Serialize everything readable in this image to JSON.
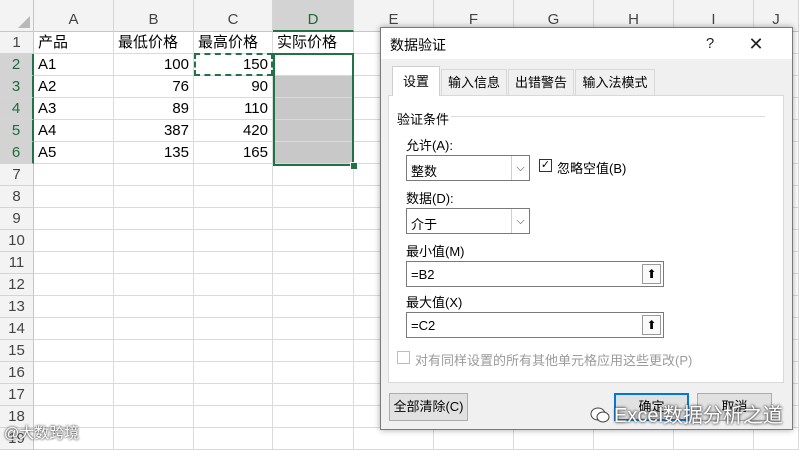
{
  "sheet": {
    "columns": [
      "A",
      "B",
      "C",
      "D",
      "E",
      "F",
      "G",
      "H",
      "I",
      "J"
    ],
    "rows": [
      "1",
      "2",
      "3",
      "4",
      "5",
      "6",
      "7",
      "8",
      "9",
      "10",
      "11",
      "12",
      "13",
      "14",
      "15",
      "16",
      "17",
      "18",
      "19"
    ],
    "header_row": [
      "产品",
      "最低价格",
      "最高价格",
      "实际价格"
    ],
    "data": [
      {
        "product": "A1",
        "min": "100",
        "max": "150"
      },
      {
        "product": "A2",
        "min": "76",
        "max": "90"
      },
      {
        "product": "A3",
        "min": "89",
        "max": "110"
      },
      {
        "product": "A4",
        "min": "387",
        "max": "420"
      },
      {
        "product": "A5",
        "min": "135",
        "max": "165"
      }
    ],
    "selected_column": "D",
    "accent": "#217346"
  },
  "dialog": {
    "title": "数据验证",
    "help": "?",
    "close": "✕",
    "tabs": [
      "设置",
      "输入信息",
      "出错警告",
      "输入法模式"
    ],
    "active_tab": "设置",
    "section": "验证条件",
    "allow_label": "允许(A):",
    "allow_value": "整数",
    "ignore_blank_label": "忽略空值(B)",
    "ignore_blank_checked": true,
    "data_label": "数据(D):",
    "data_value": "介于",
    "min_label": "最小值(M)",
    "min_value": "=B2",
    "max_label": "最大值(X)",
    "max_value": "=C2",
    "apply_all_label": "对有同样设置的所有其他单元格应用这些更改(P)",
    "clear_all": "全部清除(C)",
    "ok": "确定",
    "cancel": "取消",
    "dropdown_icon": "chevron-down-icon",
    "ref_icon": "collapse-dialog-icon"
  },
  "watermark": {
    "left": "@大数跨境",
    "right": "Excel数据分析之道"
  }
}
